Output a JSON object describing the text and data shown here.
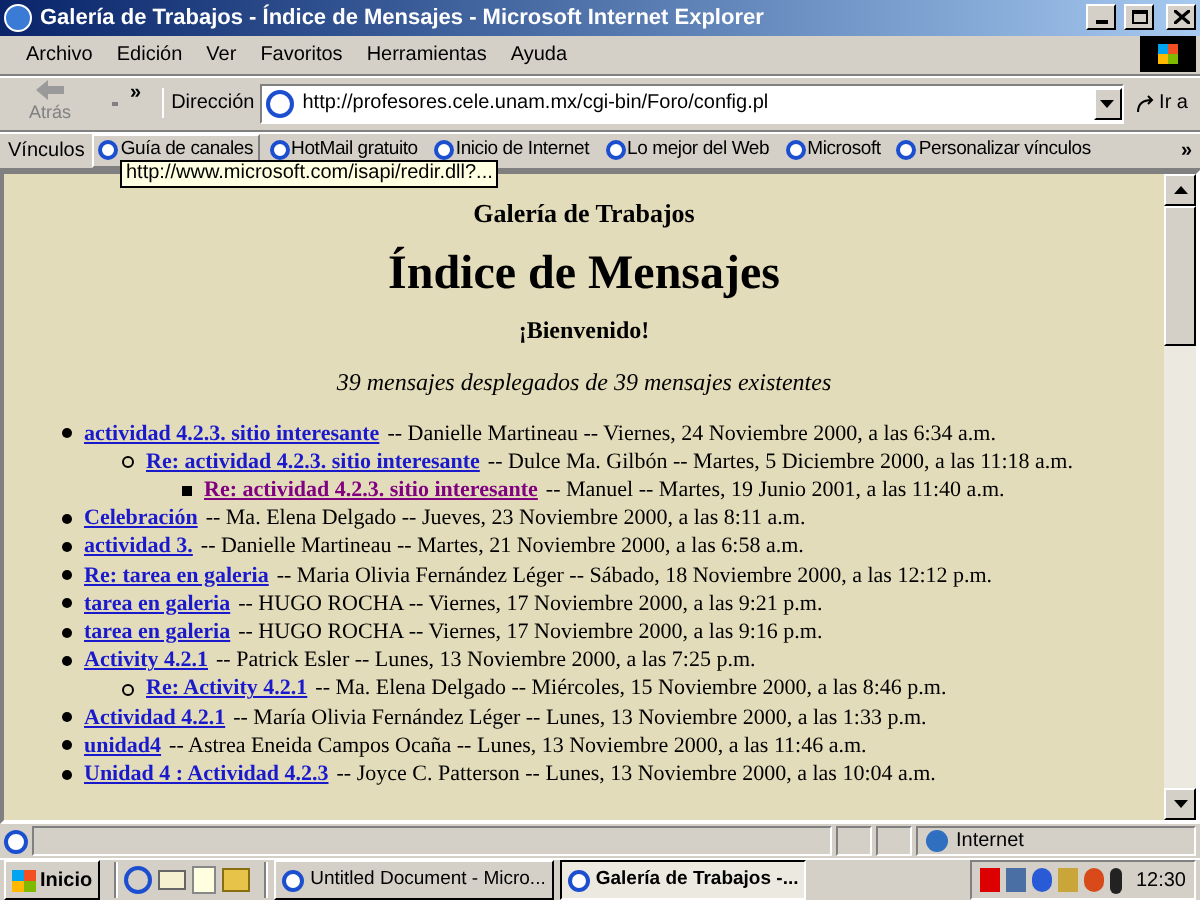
{
  "window": {
    "title": "Galería de Trabajos - Índice de Mensajes - Microsoft Internet Explorer"
  },
  "menu": [
    "Archivo",
    "Edición",
    "Ver",
    "Favoritos",
    "Herramientas",
    "Ayuda"
  ],
  "toolbar": {
    "back_label": "Atrás",
    "more": "»",
    "address_label": "Dirección",
    "address": "http://profesores.cele.unam.mx/cgi-bin/Foro/config.pl",
    "go_label": "Ir a"
  },
  "links_bar": {
    "label": "Vínculos",
    "items": [
      {
        "label": "Guía de canales",
        "selected": true
      },
      {
        "label": "HotMail gratuito",
        "selected": false
      },
      {
        "label": "Inicio de Internet",
        "selected": false
      },
      {
        "label": "Lo mejor del Web",
        "selected": false
      },
      {
        "label": "Microsoft",
        "selected": false
      },
      {
        "label": "Personalizar vínculos",
        "selected": false
      }
    ],
    "more": "»"
  },
  "tooltip": "http://www.microsoft.com/isapi/redir.dll?...",
  "page": {
    "site_title": "Galería de Trabajos",
    "heading": "Índice de Mensajes",
    "welcome": "¡Bienvenido!",
    "summary": "39 mensajes desplegados de 39 mensajes existentes",
    "messages": [
      {
        "subject": "actividad 4.2.3. sitio interesante",
        "details": "-- Danielle Martineau -- Viernes, 24 Noviembre 2000, a las 6:34 a.m.",
        "visited": false,
        "children": [
          {
            "subject": "Re: actividad 4.2.3. sitio interesante",
            "details": "-- Dulce Ma. Gilbón -- Martes, 5 Diciembre 2000, a las 11:18 a.m.",
            "visited": false,
            "children": [
              {
                "subject": "Re: actividad 4.2.3. sitio interesante",
                "details": "-- Manuel -- Martes, 19 Junio 2001, a las 11:40 a.m.",
                "visited": true
              }
            ]
          }
        ]
      },
      {
        "subject": "Celebración",
        "details": "-- Ma. Elena Delgado -- Jueves, 23 Noviembre 2000, a las 8:11 a.m.",
        "visited": false
      },
      {
        "subject": "actividad 3.",
        "details": "-- Danielle Martineau -- Martes, 21 Noviembre 2000, a las 6:58 a.m.",
        "visited": false
      },
      {
        "subject": "Re: tarea en galeria",
        "details": "-- Maria Olivia Fernández Léger -- Sábado, 18 Noviembre 2000, a las 12:12 p.m.",
        "visited": false
      },
      {
        "subject": "tarea en galeria",
        "details": "-- HUGO ROCHA -- Viernes, 17 Noviembre 2000, a las 9:21 p.m.",
        "visited": false
      },
      {
        "subject": "tarea en galeria",
        "details": "-- HUGO ROCHA -- Viernes, 17 Noviembre 2000, a las 9:16 p.m.",
        "visited": false
      },
      {
        "subject": "Activity 4.2.1",
        "details": "-- Patrick Esler -- Lunes, 13 Noviembre 2000, a las 7:25 p.m.",
        "visited": false,
        "children": [
          {
            "subject": "Re: Activity 4.2.1",
            "details": "-- Ma. Elena Delgado -- Miércoles, 15 Noviembre 2000, a las 8:46 p.m.",
            "visited": false
          }
        ]
      },
      {
        "subject": "Actividad 4.2.1",
        "details": "-- María Olivia Fernández Léger -- Lunes, 13 Noviembre 2000, a las 1:33 p.m.",
        "visited": false
      },
      {
        "subject": "unidad4",
        "details": "-- Astrea Eneida Campos Ocaña -- Lunes, 13 Noviembre 2000, a las 11:46 a.m.",
        "visited": false
      },
      {
        "subject": "Unidad 4 : Actividad 4.2.3",
        "details": "-- Joyce C. Patterson -- Lunes, 13 Noviembre 2000, a las 10:04 a.m.",
        "visited": false
      }
    ]
  },
  "status_bar": {
    "zone": "Internet"
  },
  "taskbar": {
    "start": "Inicio",
    "tasks": [
      {
        "label": "Untitled Document - Micro...",
        "selected": false
      },
      {
        "label": "Galería de Trabajos -...",
        "selected": true
      }
    ],
    "clock": "12:30"
  }
}
